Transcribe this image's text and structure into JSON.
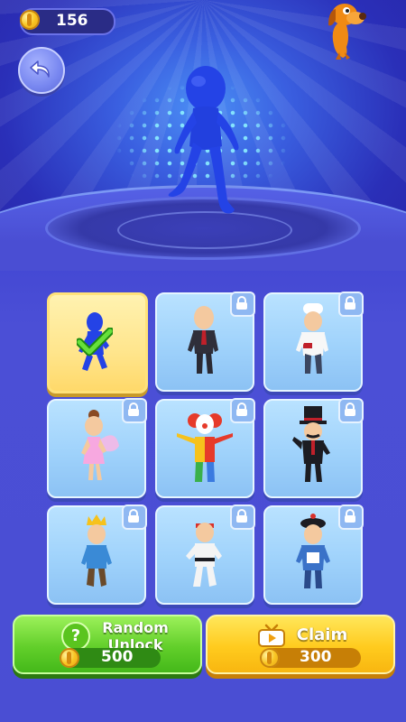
{
  "hud": {
    "coins": "156"
  },
  "grid": {
    "items": [
      {
        "name": "blue-stickman",
        "selected": true,
        "locked": false
      },
      {
        "name": "businessman",
        "selected": false,
        "locked": true
      },
      {
        "name": "chef",
        "selected": false,
        "locked": true
      },
      {
        "name": "fairy",
        "selected": false,
        "locked": true
      },
      {
        "name": "clown",
        "selected": false,
        "locked": true
      },
      {
        "name": "magician",
        "selected": false,
        "locked": true
      },
      {
        "name": "prince",
        "selected": false,
        "locked": true
      },
      {
        "name": "karate",
        "selected": false,
        "locked": true
      },
      {
        "name": "qing-official",
        "selected": false,
        "locked": true
      }
    ]
  },
  "buttons": {
    "random_unlock": {
      "line1": "Random",
      "line2": "Unlock",
      "price": "500"
    },
    "claim": {
      "label": "Claim",
      "price": "300"
    }
  },
  "colors": {
    "accent_green": "#62cf2a",
    "accent_yellow": "#ffcb1e",
    "background": "#4a4ed3",
    "hero_blue": "#2443e6"
  }
}
